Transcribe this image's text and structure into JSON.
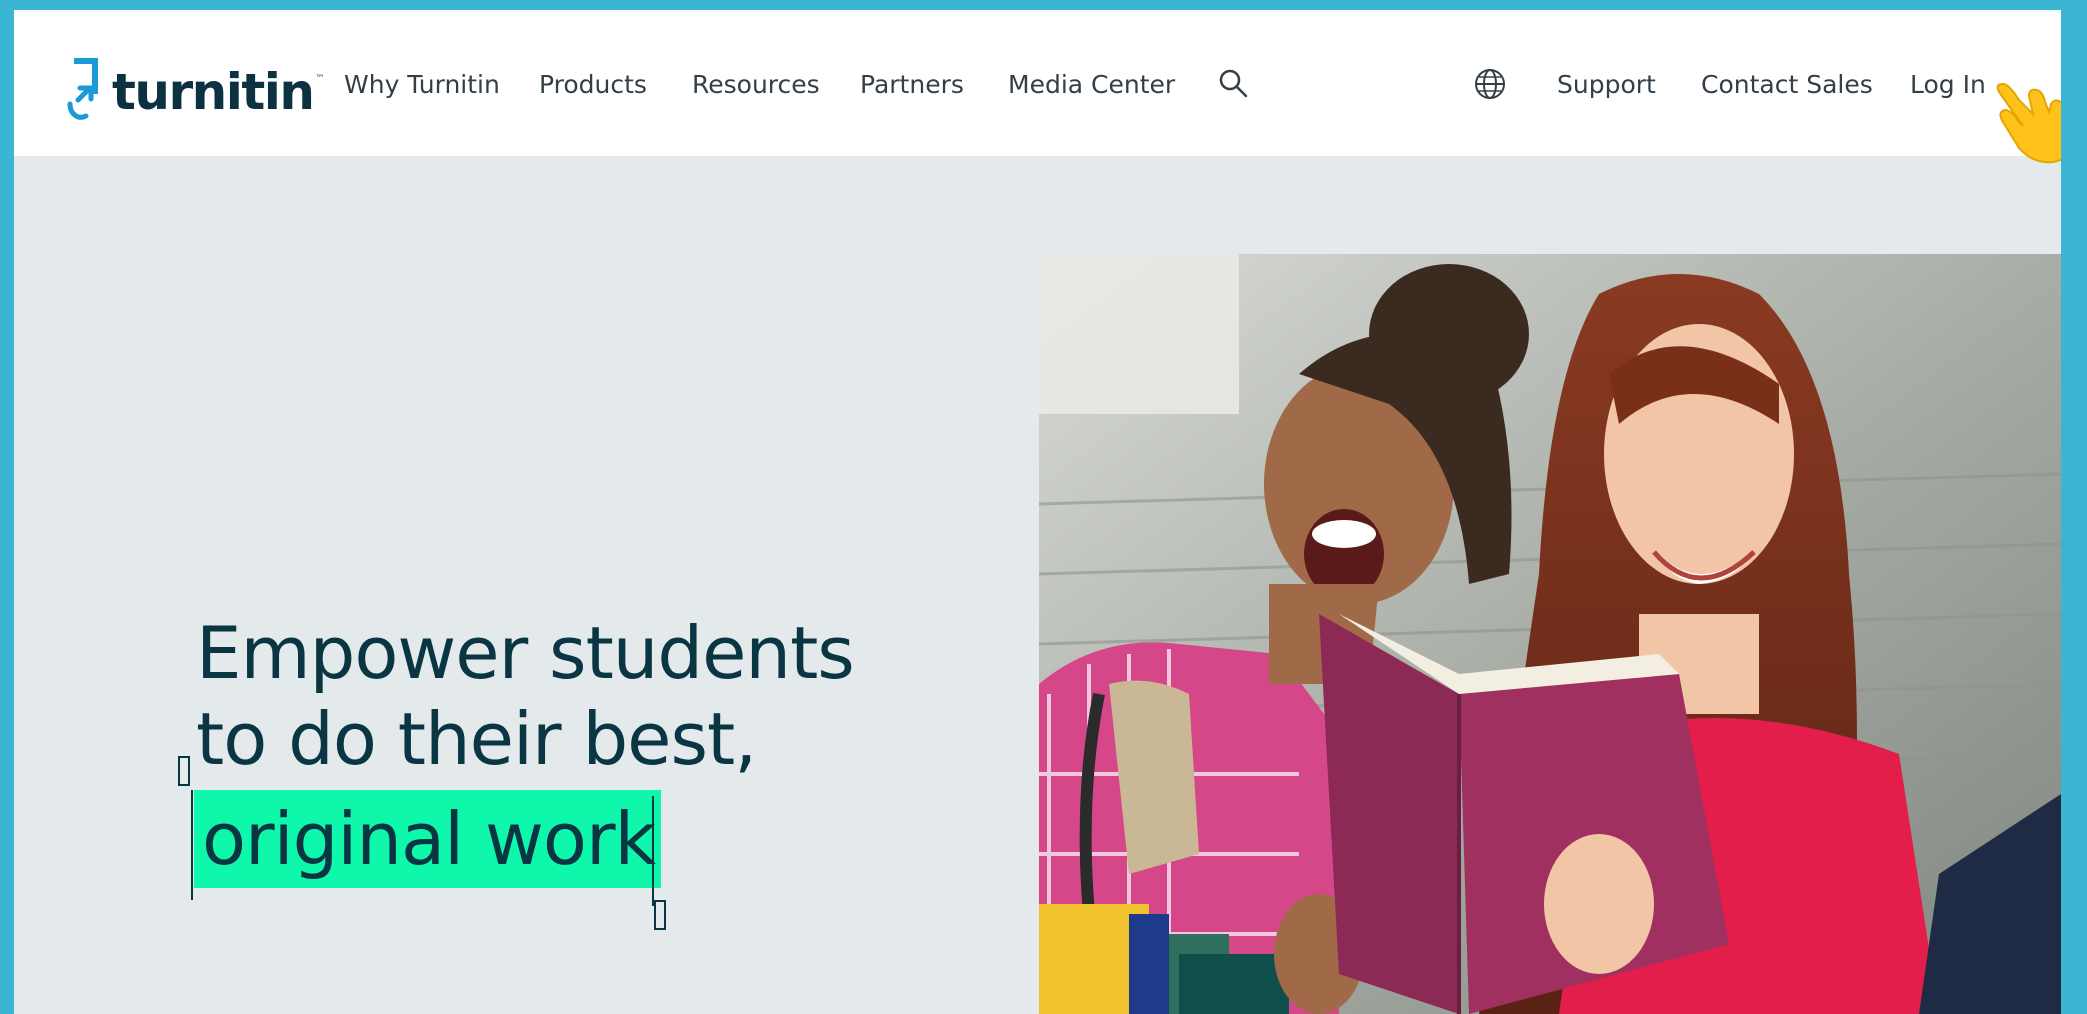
{
  "brand": {
    "name": "turnitin",
    "tm": "™",
    "color": "#0c3140",
    "accent": "#1a9ad6"
  },
  "nav": {
    "left": [
      {
        "label": "Why Turnitin"
      },
      {
        "label": "Products"
      },
      {
        "label": "Resources"
      },
      {
        "label": "Partners"
      },
      {
        "label": "Media Center"
      }
    ],
    "search_icon": "search-icon",
    "globe_icon": "globe-icon",
    "right": [
      {
        "label": "Support"
      },
      {
        "label": "Contact Sales"
      },
      {
        "label": "Log In"
      }
    ]
  },
  "hero": {
    "line1": "Empower students",
    "line2": "to do their best,",
    "highlight": "original work",
    "highlight_color": "#0ef7aa",
    "text_color": "#0a3542"
  },
  "colors": {
    "frame": "#3cb4d4",
    "hero_bg": "#e4e9ec",
    "cursor": "#ffc21a"
  }
}
